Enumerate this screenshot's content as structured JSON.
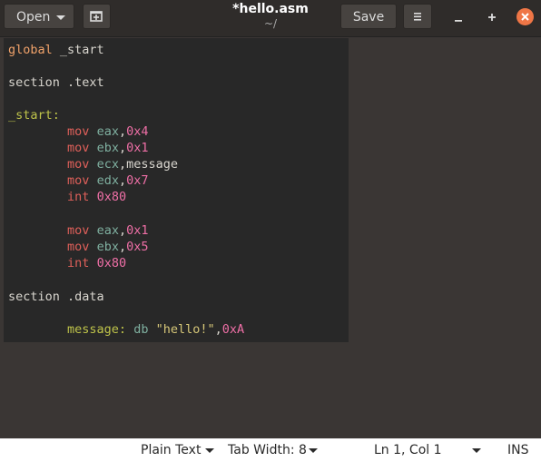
{
  "header": {
    "open_label": "Open",
    "title": "*hello.asm",
    "subtitle": "~/",
    "save_label": "Save"
  },
  "code": {
    "l1": {
      "kw": "global",
      "rest": " _start"
    },
    "l2": {
      "kw": "section",
      "rest": " .text"
    },
    "l3": {
      "label": "_start:"
    },
    "l4": {
      "instr": "mov",
      "reg": "eax",
      "comma": ",",
      "val": "0x4"
    },
    "l5": {
      "instr": "mov",
      "reg": "ebx",
      "comma": ",",
      "val": "0x1"
    },
    "l6": {
      "instr": "mov",
      "reg": "ecx",
      "comma": ",",
      "val": "message"
    },
    "l7": {
      "instr": "mov",
      "reg": "edx",
      "comma": ",",
      "val": "0x7"
    },
    "l8": {
      "instr": "int",
      "val": "0x80"
    },
    "l9": {
      "instr": "mov",
      "reg": "eax",
      "comma": ",",
      "val": "0x1"
    },
    "l10": {
      "instr": "mov",
      "reg": "ebx",
      "comma": ",",
      "val": "0x5"
    },
    "l11": {
      "instr": "int",
      "val": "0x80"
    },
    "l12": {
      "kw": "section",
      "rest": " .data"
    },
    "l13": {
      "label": "message:",
      "db": "db",
      "str": "\"hello!\"",
      "comma": ",",
      "val": "0xA"
    }
  },
  "status": {
    "language": "Plain Text",
    "tab_width": "Tab Width: 8",
    "position": "Ln 1, Col 1",
    "mode": "INS"
  },
  "colors": {
    "close_button": "#ef7646",
    "editor_background": "#282828",
    "window_background": "#3a3634"
  }
}
